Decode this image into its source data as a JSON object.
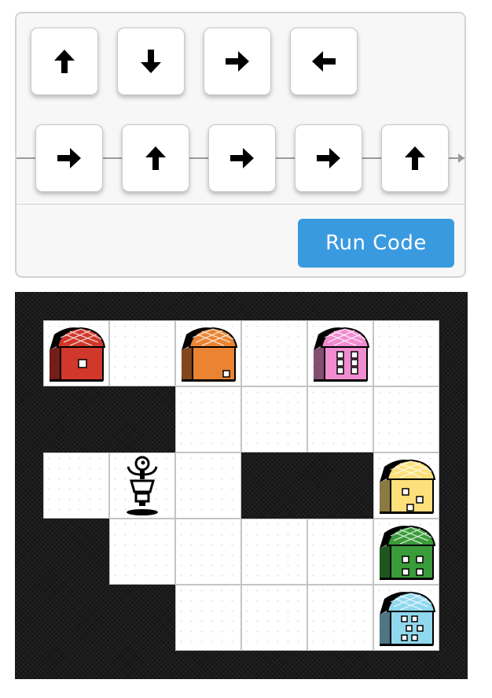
{
  "palette": {
    "commands": [
      {
        "dir": "up",
        "icon": "up-arrow-icon"
      },
      {
        "dir": "down",
        "icon": "down-arrow-icon"
      },
      {
        "dir": "right",
        "icon": "right-arrow-icon"
      },
      {
        "dir": "left",
        "icon": "left-arrow-icon"
      }
    ]
  },
  "program": {
    "steps": [
      "right",
      "up",
      "right",
      "right",
      "up"
    ]
  },
  "run_button": {
    "label": "Run Code"
  },
  "board": {
    "columns": 6,
    "rows": 5,
    "open_cells": [
      [
        0,
        0
      ],
      [
        0,
        1
      ],
      [
        0,
        2
      ],
      [
        0,
        3
      ],
      [
        0,
        4
      ],
      [
        0,
        5
      ],
      [
        1,
        2
      ],
      [
        1,
        3
      ],
      [
        1,
        4
      ],
      [
        1,
        5
      ],
      [
        2,
        0
      ],
      [
        2,
        1
      ],
      [
        2,
        2
      ],
      [
        2,
        5
      ],
      [
        3,
        1
      ],
      [
        3,
        2
      ],
      [
        3,
        3
      ],
      [
        3,
        4
      ],
      [
        3,
        5
      ],
      [
        4,
        2
      ],
      [
        4,
        3
      ],
      [
        4,
        4
      ],
      [
        4,
        5
      ]
    ],
    "houses": [
      {
        "row": 0,
        "col": 0,
        "color": "#d1372a",
        "name": "red-house"
      },
      {
        "row": 0,
        "col": 2,
        "color": "#ea8433",
        "name": "orange-house"
      },
      {
        "row": 0,
        "col": 4,
        "color": "#f08ccf",
        "name": "pink-house"
      },
      {
        "row": 2,
        "col": 5,
        "color": "#fde07a",
        "name": "yellow-house"
      },
      {
        "row": 3,
        "col": 5,
        "color": "#3a9b3a",
        "name": "green-house"
      },
      {
        "row": 4,
        "col": 5,
        "color": "#8fd8ee",
        "name": "blue-house"
      }
    ],
    "robot": {
      "row": 2,
      "col": 1
    }
  }
}
